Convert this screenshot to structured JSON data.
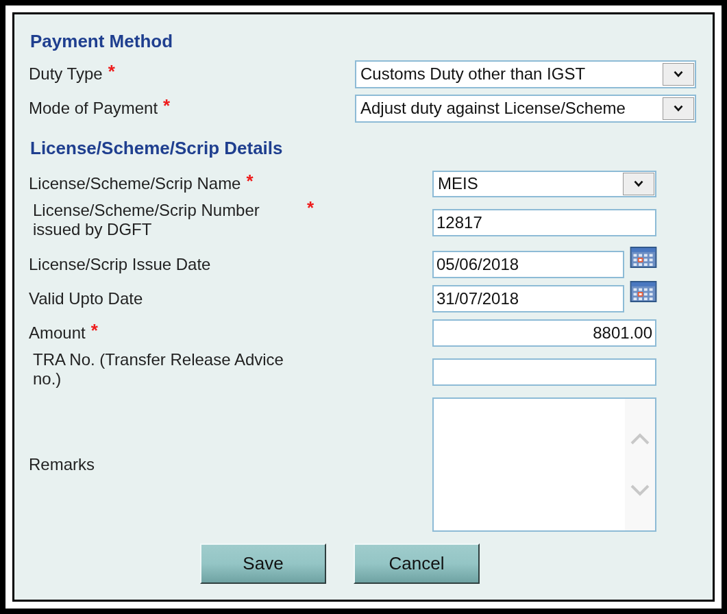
{
  "sections": [
    {
      "heading": "Payment Method",
      "fields": [
        {
          "kind": "select",
          "label": "Duty Type",
          "required_mark": "*",
          "value": "Customs Duty other than IGST"
        },
        {
          "kind": "select",
          "label": "Mode of Payment",
          "required_mark": "*",
          "value": "Adjust duty against License/Scheme"
        }
      ]
    },
    {
      "heading": "License/Scheme/Scrip Details",
      "fields": [
        {
          "kind": "select",
          "label": "License/Scheme/Scrip Name",
          "required_mark": "*",
          "value": "MEIS"
        },
        {
          "kind": "text",
          "label": "License/Scheme/Scrip Number issued by DGFT",
          "required_mark": "*",
          "value": "12817"
        },
        {
          "kind": "date",
          "label": "License/Scrip Issue Date",
          "value": "05/06/2018"
        },
        {
          "kind": "date",
          "label": "Valid Upto Date",
          "value": "31/07/2018"
        },
        {
          "kind": "number",
          "label": "Amount",
          "required_mark": "*",
          "value": "8801.00"
        },
        {
          "kind": "text",
          "label": "TRA No. (Transfer Release Advice no.)"
        },
        {
          "kind": "textarea",
          "label": "Remarks"
        }
      ]
    }
  ],
  "buttons": [
    "Save",
    "Cancel"
  ]
}
